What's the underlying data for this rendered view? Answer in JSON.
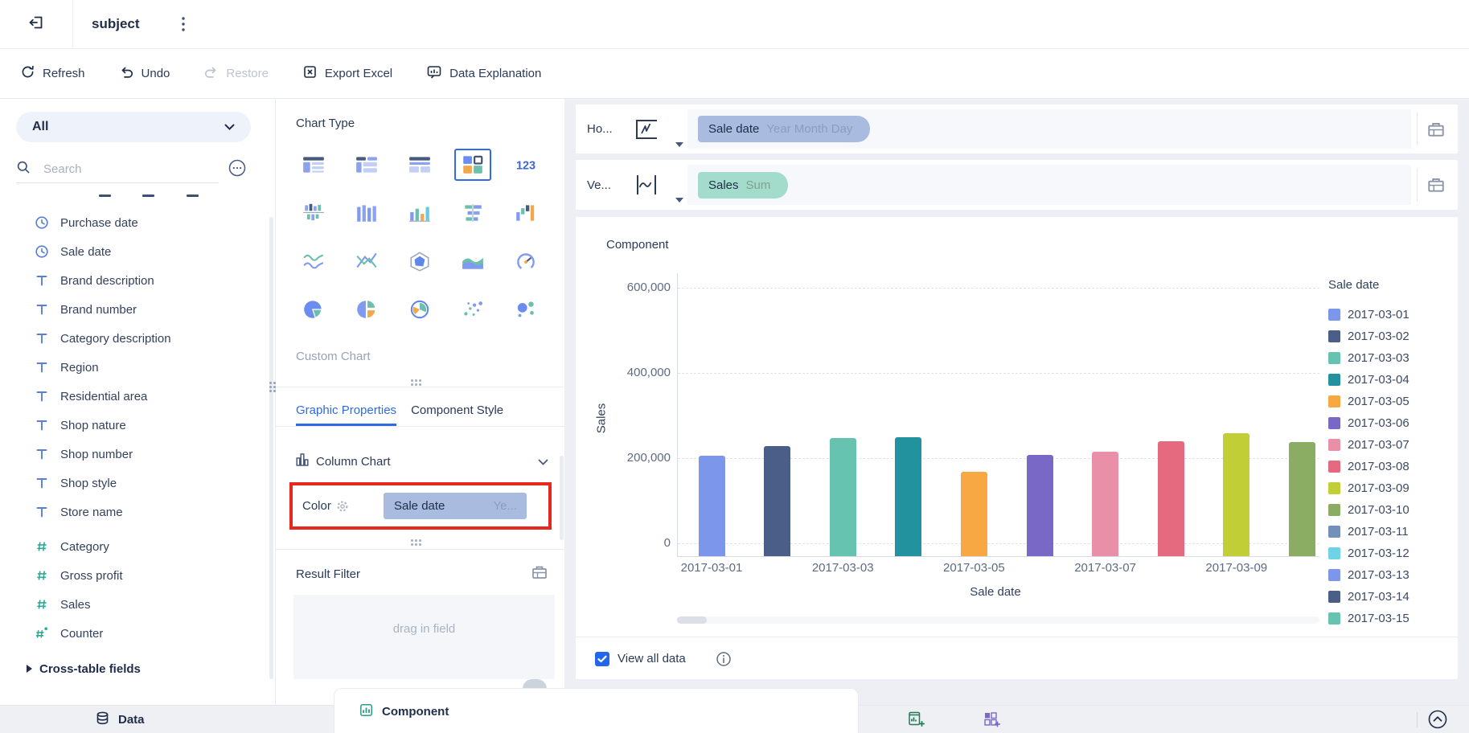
{
  "window": {
    "title": "subject"
  },
  "toolbar": {
    "items": [
      {
        "label": "Refresh",
        "icon": "refresh-icon",
        "enabled": true
      },
      {
        "label": "Undo",
        "icon": "undo-icon",
        "enabled": true
      },
      {
        "label": "Restore",
        "icon": "redo-icon",
        "enabled": false
      },
      {
        "label": "Export Excel",
        "icon": "excel-icon",
        "enabled": true
      },
      {
        "label": "Data Explanation",
        "icon": "data-explanation-icon",
        "enabled": true
      }
    ]
  },
  "sidebar": {
    "dataset_selector": {
      "label": "All"
    },
    "search": {
      "placeholder": "Search"
    },
    "fields": [
      {
        "label": "Purchase date",
        "type": "date"
      },
      {
        "label": "Sale date",
        "type": "date"
      },
      {
        "label": "Brand description",
        "type": "text"
      },
      {
        "label": "Brand number",
        "type": "text"
      },
      {
        "label": "Category description",
        "type": "text"
      },
      {
        "label": "Region",
        "type": "text"
      },
      {
        "label": "Residential area",
        "type": "text"
      },
      {
        "label": "Shop nature",
        "type": "text"
      },
      {
        "label": "Shop number",
        "type": "text"
      },
      {
        "label": "Shop style",
        "type": "text"
      },
      {
        "label": "Store name",
        "type": "text"
      },
      {
        "label": "Category",
        "type": "number"
      },
      {
        "label": "Gross profit",
        "type": "number"
      },
      {
        "label": "Sales",
        "type": "number"
      },
      {
        "label": "Counter",
        "type": "counter"
      }
    ],
    "group_row": {
      "label": "Cross-table fields"
    }
  },
  "chart_panel": {
    "title": "Chart Type",
    "chart_types": [
      {
        "name": "table",
        "selected": false
      },
      {
        "name": "grouped-table",
        "selected": false
      },
      {
        "name": "cross-table",
        "selected": false
      },
      {
        "name": "multi-kpi",
        "selected": true
      },
      {
        "name": "kpi-card",
        "selected": false
      },
      {
        "name": "stacked-column",
        "selected": false
      },
      {
        "name": "column",
        "selected": false
      },
      {
        "name": "multi-series-column",
        "selected": false
      },
      {
        "name": "bar",
        "selected": false
      },
      {
        "name": "waterfall",
        "selected": false
      },
      {
        "name": "line",
        "selected": false
      },
      {
        "name": "multi-line",
        "selected": false
      },
      {
        "name": "radar",
        "selected": false
      },
      {
        "name": "area",
        "selected": false
      },
      {
        "name": "gauge",
        "selected": false
      },
      {
        "name": "pie",
        "selected": false
      },
      {
        "name": "multi-pie",
        "selected": false
      },
      {
        "name": "rose",
        "selected": false
      },
      {
        "name": "scatter",
        "selected": false
      },
      {
        "name": "bubble",
        "selected": false
      }
    ],
    "custom_chart_label": "Custom Chart",
    "tabs": [
      {
        "label": "Graphic Properties",
        "active": true
      },
      {
        "label": "Component Style",
        "active": false
      }
    ],
    "chart_style_section": {
      "label": "Column Chart"
    },
    "color_row": {
      "label": "Color",
      "pill_field": "Sale date",
      "pill_detail": "Ye...",
      "pill_color": "#a9bcdf",
      "highlighted": true,
      "highlight_color": "#e8281e"
    },
    "result_filter": {
      "label": "Result Filter",
      "drag_hint": "drag in field"
    }
  },
  "shelves": {
    "horizontal": {
      "label": "Ho...",
      "pill": {
        "field": "Sale date",
        "detail": "Year Month Day",
        "color": "#a9bcdf"
      }
    },
    "vertical": {
      "label": "Ve...",
      "pill": {
        "field": "Sales",
        "detail": "Sum",
        "color": "#a4dccc"
      }
    }
  },
  "component": {
    "title": "Component",
    "footer": {
      "view_all_data": "View all data",
      "checked": true
    }
  },
  "bottom_bar": {
    "data_tab": "Data",
    "component_tab": "Component"
  },
  "colors": {
    "accent_blue": "#2e6ae8",
    "annotation_red": "#e8281e",
    "checkbox_blue": "#2466eb"
  },
  "chart_data": {
    "type": "bar",
    "title": "Component",
    "xlabel": "Sale date",
    "ylabel": "Sales",
    "ylim": [
      0,
      600000
    ],
    "ytick_labels": [
      "0",
      "200,000",
      "400,000",
      "600,000"
    ],
    "categories": [
      "2017-03-01",
      "2017-03-02",
      "2017-03-03",
      "2017-03-04",
      "2017-03-05",
      "2017-03-06",
      "2017-03-07",
      "2017-03-08",
      "2017-03-09",
      "2017-03-10"
    ],
    "values": [
      205000,
      228000,
      248000,
      250000,
      168000,
      207000,
      215000,
      240000,
      258000,
      238000
    ],
    "x_axis_labels_shown": [
      "2017-03-01",
      "2017-03-03",
      "2017-03-05",
      "2017-03-07",
      "2017-03-09"
    ],
    "grid": true,
    "legend": {
      "title": "Sale date",
      "position": "right",
      "items": [
        {
          "label": "2017-03-01",
          "color": "#7b96ea"
        },
        {
          "label": "2017-03-02",
          "color": "#4a5e88"
        },
        {
          "label": "2017-03-03",
          "color": "#65c3af"
        },
        {
          "label": "2017-03-04",
          "color": "#22939e"
        },
        {
          "label": "2017-03-05",
          "color": "#f7a843"
        },
        {
          "label": "2017-03-06",
          "color": "#7a68c7"
        },
        {
          "label": "2017-03-07",
          "color": "#e98fa7"
        },
        {
          "label": "2017-03-08",
          "color": "#e56a7f"
        },
        {
          "label": "2017-03-09",
          "color": "#c2ce35"
        },
        {
          "label": "2017-03-10",
          "color": "#8bac63"
        },
        {
          "label": "2017-03-11",
          "color": "#7291ba"
        },
        {
          "label": "2017-03-12",
          "color": "#6fd3e7"
        },
        {
          "label": "2017-03-13",
          "color": "#7b96ea"
        },
        {
          "label": "2017-03-14",
          "color": "#4a5e88"
        },
        {
          "label": "2017-03-15",
          "color": "#65c3af"
        }
      ]
    }
  }
}
